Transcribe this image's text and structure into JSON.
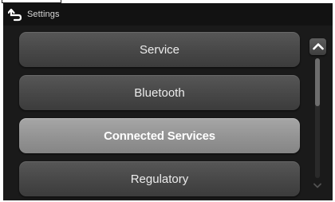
{
  "header": {
    "title": "Settings",
    "back_icon": "back-arrow-icon"
  },
  "menu": {
    "items": [
      {
        "label": "Service",
        "selected": false
      },
      {
        "label": "Bluetooth",
        "selected": false
      },
      {
        "label": "Connected Services",
        "selected": true
      },
      {
        "label": "Regulatory",
        "selected": false
      }
    ]
  },
  "scrollbar": {
    "up_icon": "chevron-up-icon",
    "down_icon": "chevron-down-icon"
  },
  "colors": {
    "screen_bg": "#1a1a1a",
    "item_bg": "#4a4a4a",
    "selected_bg": "#9a9a9a",
    "text": "#ececec"
  }
}
